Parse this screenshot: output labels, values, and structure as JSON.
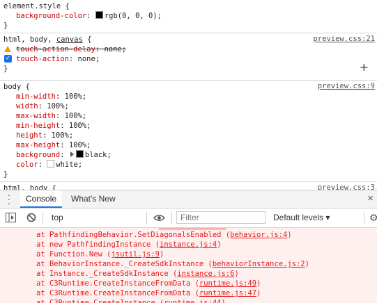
{
  "styles": {
    "element_style": {
      "selector": "element.style {",
      "prop": "background-color",
      "value": "rgb(0, 0, 0);",
      "close": "}"
    },
    "html_body_canvas": {
      "sel_a": "html, body, ",
      "sel_b": "canvas",
      "sel_c": " {",
      "source": "preview.css:21",
      "decl1_prop": "touch-action-delay",
      "decl1_val": "none;",
      "decl2_prop": "touch-action",
      "decl2_val": "none;",
      "close": "}"
    },
    "body_rule": {
      "selector": "body {",
      "source": "preview.css:9",
      "decls": [
        {
          "prop": "min-width",
          "val": "100%;"
        },
        {
          "prop": "width",
          "val": "100%;"
        },
        {
          "prop": "max-width",
          "val": "100%;"
        },
        {
          "prop": "min-height",
          "val": "100%;"
        },
        {
          "prop": "height",
          "val": "100%;"
        },
        {
          "prop": "max-height",
          "val": "100%;"
        }
      ],
      "bg_prop": "background",
      "bg_val": "black;",
      "color_prop": "color",
      "color_val": "white;",
      "close": "}"
    },
    "partial_rule": {
      "selector": "html, body {",
      "source": "preview.css:3"
    }
  },
  "drawer": {
    "tabs": [
      "Console",
      "What's New"
    ],
    "close": "×",
    "context": "top",
    "filter_placeholder": "Filter",
    "levels": "Default levels ▾"
  },
  "logs": [
    {
      "text": "at PathfindingBehavior.SetDiagonalsEnabled (",
      "link": "behavior.js:4",
      "end": ")"
    },
    {
      "text": "at new PathfindingInstance (",
      "link": "instance.js:4",
      "end": ")"
    },
    {
      "text": "at Function.New (",
      "link": "jsutil.js:9",
      "end": ")"
    },
    {
      "text": "at BehaviorInstance._CreateSdkInstance (",
      "link": "behaviorInstance.js:2",
      "end": ")"
    },
    {
      "text": "at Instance._CreateSdkInstance (",
      "link": "instance.js:6",
      "end": ")"
    },
    {
      "text": "at C3Runtime.CreateInstanceFromData (",
      "link": "runtime.js:49",
      "end": ")"
    },
    {
      "text": "at C3Runtime.CreateInstanceFromData (",
      "link": "runtime.js:47",
      "end": ")"
    },
    {
      "text": "at C3Runtime.CreateInstance (",
      "link": "runtime.js:44",
      "end": ")"
    }
  ],
  "colors": {
    "error_text": "#e41a1a",
    "error_bg": "#fff0f0",
    "accent": "#1a73e8",
    "property": "#c80000"
  }
}
